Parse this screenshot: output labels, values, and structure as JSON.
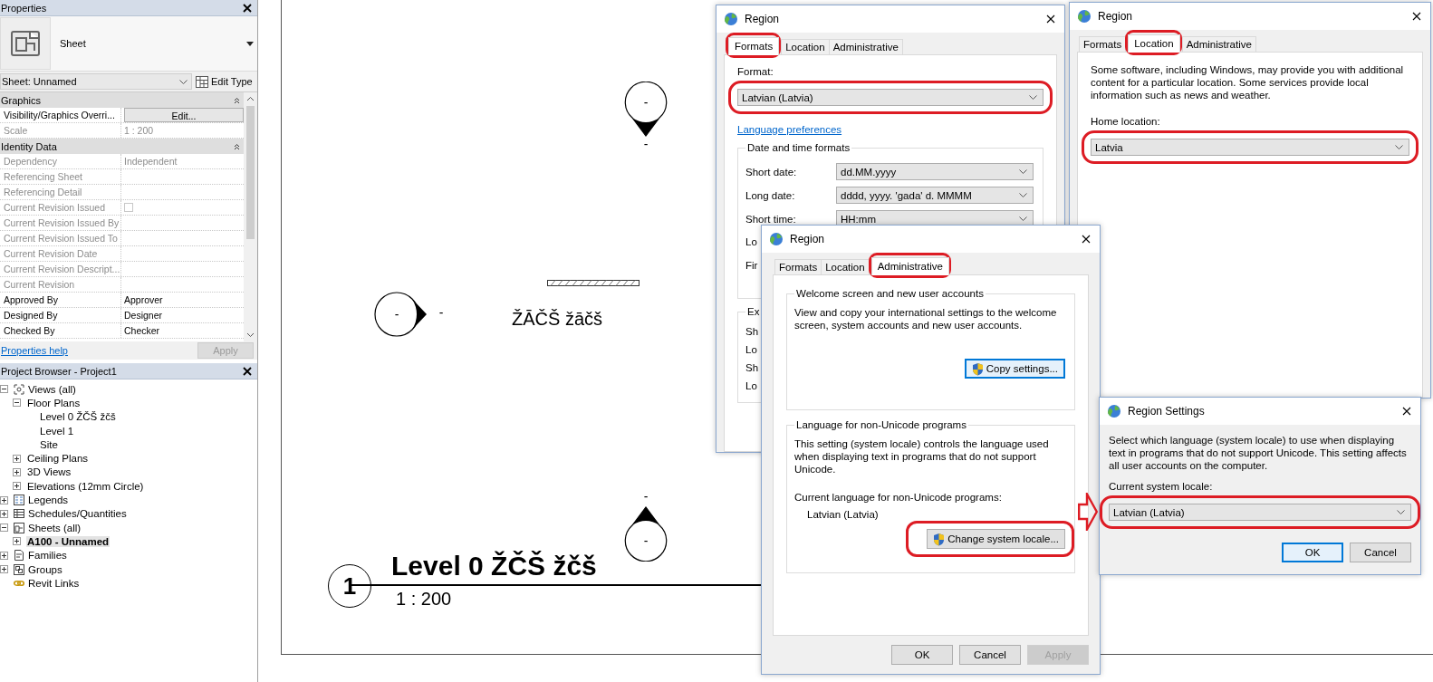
{
  "properties": {
    "title": "Properties",
    "type_name": "Sheet",
    "instance": "Sheet: Unnamed",
    "edit_type": "Edit Type",
    "groups": [
      {
        "title": "Graphics",
        "rows": [
          {
            "label": "Visibility/Graphics Overri...",
            "kind": "button",
            "value": "Edit...",
            "disabled": false
          },
          {
            "label": "Scale",
            "kind": "text",
            "value": "1 : 200",
            "disabled": true
          }
        ]
      },
      {
        "title": "Identity Data",
        "rows": [
          {
            "label": "Dependency",
            "kind": "text",
            "value": "Independent",
            "disabled": true
          },
          {
            "label": "Referencing Sheet",
            "kind": "text",
            "disabled": true
          },
          {
            "label": "Referencing Detail",
            "kind": "text",
            "disabled": true
          },
          {
            "label": "Current Revision Issued",
            "kind": "checkbox",
            "checked": false,
            "disabled": true
          },
          {
            "label": "Current Revision Issued By",
            "kind": "text",
            "disabled": true
          },
          {
            "label": "Current Revision Issued To",
            "kind": "text",
            "disabled": true
          },
          {
            "label": "Current Revision Date",
            "kind": "text",
            "disabled": true
          },
          {
            "label": "Current Revision Descript...",
            "kind": "text",
            "disabled": true
          },
          {
            "label": "Current Revision",
            "kind": "text",
            "disabled": true
          },
          {
            "label": "Approved By",
            "kind": "text",
            "value": "Approver",
            "disabled": false
          },
          {
            "label": "Designed By",
            "kind": "text",
            "value": "Designer",
            "disabled": false
          },
          {
            "label": "Checked By",
            "kind": "text",
            "value": "Checker",
            "disabled": false
          }
        ]
      }
    ],
    "help_link": "Properties help",
    "apply": {
      "label": "Apply",
      "disabled": true
    }
  },
  "browser": {
    "title": "Project Browser - Project1",
    "tree": [
      {
        "label": "Views (all)",
        "kind": "views",
        "expanded": true,
        "selected": false,
        "children": [
          {
            "label": "Floor Plans",
            "expanded": true,
            "selected": false,
            "children": [
              {
                "label": "Level 0 ŽČŠ žčš",
                "selected": false
              },
              {
                "label": "Level 1",
                "selected": false
              },
              {
                "label": "Site",
                "selected": false
              }
            ]
          },
          {
            "label": "Ceiling Plans",
            "expanded": false,
            "selected": false
          },
          {
            "label": "3D Views",
            "expanded": false,
            "selected": false
          },
          {
            "label": "Elevations (12mm Circle)",
            "expanded": false,
            "selected": false
          }
        ]
      },
      {
        "label": "Legends",
        "kind": "legends",
        "expanded": false,
        "selected": false
      },
      {
        "label": "Schedules/Quantities",
        "kind": "schedules",
        "expanded": false,
        "selected": false
      },
      {
        "label": "Sheets (all)",
        "kind": "sheets",
        "expanded": true,
        "selected": false,
        "children": [
          {
            "label": "A100 - Unnamed",
            "expanded": false,
            "selected": true
          }
        ]
      },
      {
        "label": "Families",
        "kind": "families",
        "expanded": false,
        "selected": false
      },
      {
        "label": "Groups",
        "kind": "groups",
        "expanded": false,
        "selected": false
      },
      {
        "label": "Revit Links",
        "kind": "links",
        "selected": false
      }
    ]
  },
  "sheet": {
    "markers": [
      {
        "kind": "elevation-down",
        "label": "-",
        "tag": "-"
      },
      {
        "kind": "section-right",
        "label": "-",
        "tag": "-"
      },
      {
        "kind": "elevation-up",
        "label": "-",
        "tag": "-"
      }
    ],
    "text_note": "ŽĀČŠ žāčš",
    "view_title": {
      "number": "1",
      "name": "Level 0 ŽČŠ žčš",
      "scale": "1 : 200"
    }
  },
  "dialogs": [
    {
      "kind": "formats",
      "title": "Region",
      "tabs": [
        {
          "label": "Formats",
          "selected": true,
          "highlighted": true
        },
        {
          "label": "Location",
          "selected": false,
          "highlighted": false
        },
        {
          "label": "Administrative",
          "selected": false,
          "highlighted": false
        }
      ],
      "format": {
        "label": "Format:",
        "value": "Latvian (Latvia)",
        "highlighted": true
      },
      "link": "Language preferences",
      "group": "Date and time formats",
      "fields": [
        {
          "label": "Short date:",
          "value": "dd.MM.yyyy"
        },
        {
          "label": "Long date:",
          "value": "dddd, yyyy. 'gada' d. MMMM"
        },
        {
          "label": "Short time:",
          "value": "HH:mm"
        }
      ],
      "partial_labels": [
        "Lo",
        "Fir"
      ],
      "examples": {
        "title": "Ex",
        "labels": [
          "Sh",
          "Lo",
          "Sh",
          "Lo"
        ]
      }
    },
    {
      "kind": "location",
      "title": "Region",
      "tabs": [
        {
          "label": "Formats",
          "selected": false,
          "highlighted": false
        },
        {
          "label": "Location",
          "selected": true,
          "highlighted": true
        },
        {
          "label": "Administrative",
          "selected": false,
          "highlighted": false
        }
      ],
      "text": "Some software, including Windows, may provide you with additional content for a particular location. Some services provide local information such as news and weather.",
      "home": {
        "label": "Home location:",
        "value": "Latvia",
        "highlighted": true
      }
    },
    {
      "kind": "administrative",
      "title": "Region",
      "tabs": [
        {
          "label": "Formats",
          "selected": false,
          "highlighted": false
        },
        {
          "label": "Location",
          "selected": false,
          "highlighted": false
        },
        {
          "label": "Administrative",
          "selected": true,
          "highlighted": true
        }
      ],
      "groups": [
        {
          "title": "Welcome screen and new user accounts",
          "text": "View and copy your international settings to the welcome screen, system accounts and new user accounts.",
          "button": {
            "label": "Copy settings...",
            "focused": true,
            "highlighted": false
          }
        },
        {
          "title": "Language for non-Unicode programs",
          "text": "This setting (system locale) controls the language used when displaying text in programs that do not support Unicode.",
          "current_label": "Current language for non-Unicode programs:",
          "current_value": "Latvian (Latvia)",
          "button": {
            "label": "Change system locale...",
            "focused": false,
            "highlighted": true
          }
        }
      ],
      "buttons": [
        {
          "label": "OK",
          "disabled": false
        },
        {
          "label": "Cancel",
          "disabled": false
        },
        {
          "label": "Apply",
          "disabled": true
        }
      ]
    },
    {
      "kind": "settings",
      "title": "Region Settings",
      "text": "Select which language (system locale) to use when displaying text in programs that do not support Unicode. This setting affects all user accounts on the computer.",
      "locale": {
        "label": "Current system locale:",
        "value": "Latvian (Latvia)",
        "highlighted": true
      },
      "buttons": [
        {
          "label": "OK",
          "focused": true
        },
        {
          "label": "Cancel",
          "focused": false
        }
      ]
    }
  ]
}
